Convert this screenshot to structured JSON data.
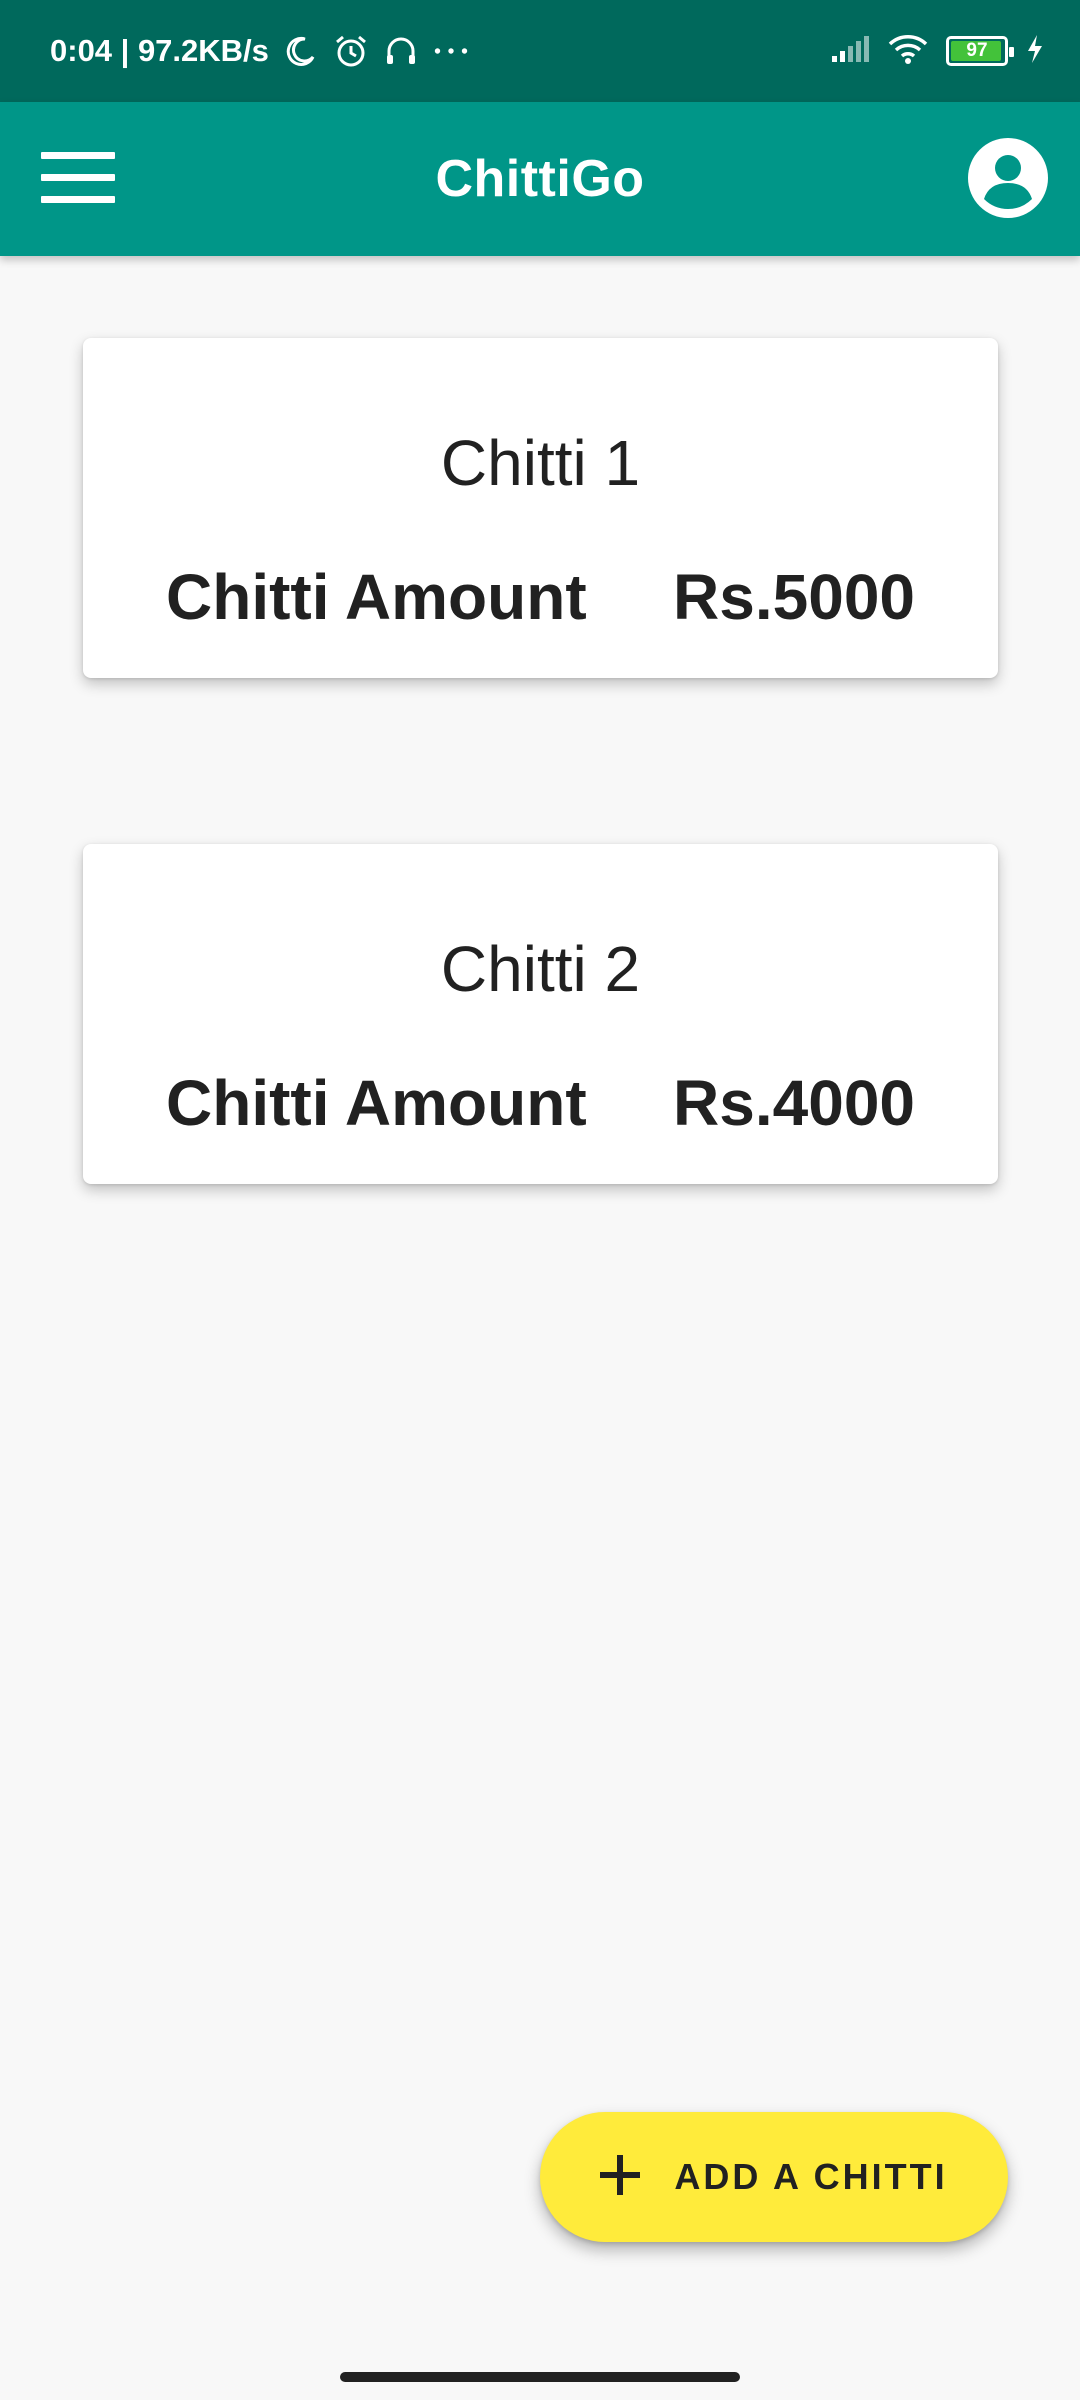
{
  "status_bar": {
    "time_and_speed": "0:04 | 97.2KB/s",
    "battery_level": "97",
    "battery_fraction": 0.97,
    "icons": [
      "moon-icon",
      "alarm-icon",
      "headset-icon",
      "more-dots-icon",
      "signal-icon",
      "wifi-icon",
      "battery-icon",
      "charging-icon"
    ]
  },
  "app_bar": {
    "title": "ChittiGo",
    "menu_icon": "hamburger-menu-icon",
    "account_icon": "account-circle-icon"
  },
  "chittis": [
    {
      "name": "Chitti 1",
      "amount_label": "Chitti Amount",
      "amount": "Rs.5000"
    },
    {
      "name": "Chitti 2",
      "amount_label": "Chitti Amount",
      "amount": "Rs.4000"
    }
  ],
  "fab": {
    "label": "ADD A CHITTI",
    "icon": "plus-icon"
  },
  "colors": {
    "status_bar": "#00695c",
    "app_bar": "#009688",
    "fab": "#ffeb3b",
    "background": "#f8f8f8",
    "battery_fill": "#43c23a"
  }
}
